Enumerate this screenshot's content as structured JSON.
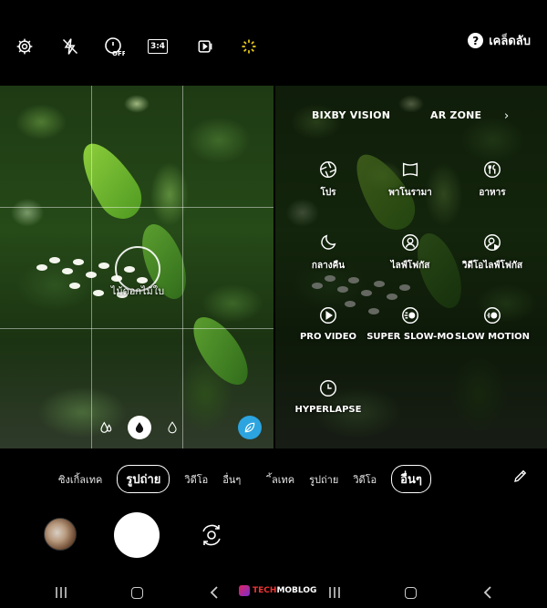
{
  "top_bar": {
    "icons": [
      "settings-icon",
      "flash-off-icon",
      "timer-off-icon",
      "ratio-icon",
      "motion-photo-icon",
      "scene-optimizer-icon"
    ],
    "ratio_label": "3:4",
    "timer_label": "OFF",
    "tips_label": "เคล็ดลับ"
  },
  "left_view": {
    "focus_label": "ไม้ดอกไม้ใบ",
    "filters": [
      "water-drop-small-icon",
      "water-drop-icon",
      "water-drop-outline-icon"
    ],
    "scene_icon": "leaf-icon",
    "accent_color": "#2ca4e0"
  },
  "right_view": {
    "bixby_vision": "BIXBY VISION",
    "ar_zone": "AR ZONE",
    "modes": [
      {
        "label": "โปร",
        "icon": "aperture-icon"
      },
      {
        "label": "พาโนรามา",
        "icon": "panorama-icon"
      },
      {
        "label": "อาหาร",
        "icon": "food-icon"
      },
      {
        "label": "กลางคืน",
        "icon": "night-moon-icon"
      },
      {
        "label": "ไลฟ์โฟกัส",
        "icon": "live-focus-icon"
      },
      {
        "label": "วิดีโอไลฟ์โฟกัส",
        "icon": "live-focus-video-icon"
      },
      {
        "label": "PRO VIDEO",
        "icon": "pro-video-icon"
      },
      {
        "label": "SUPER SLOW-MO",
        "icon": "super-slow-mo-icon"
      },
      {
        "label": "SLOW MOTION",
        "icon": "slow-motion-icon"
      },
      {
        "label": "HYPERLAPSE",
        "icon": "hyperlapse-icon"
      }
    ]
  },
  "mode_bar_left": {
    "items": [
      "ซิงเกิ้ลเทค",
      "รูปถ่าย",
      "วิดีโอ",
      "อื่นๆ"
    ],
    "active": "รูปถ่าย"
  },
  "mode_bar_right": {
    "items": [
      "ิ้ลเทค",
      "รูปถ่าย",
      "วิดีโอ",
      "อื่นๆ"
    ],
    "active": "อื่นๆ"
  },
  "watermark": {
    "text_red": "TECH",
    "text_white": "MOBLOG"
  }
}
